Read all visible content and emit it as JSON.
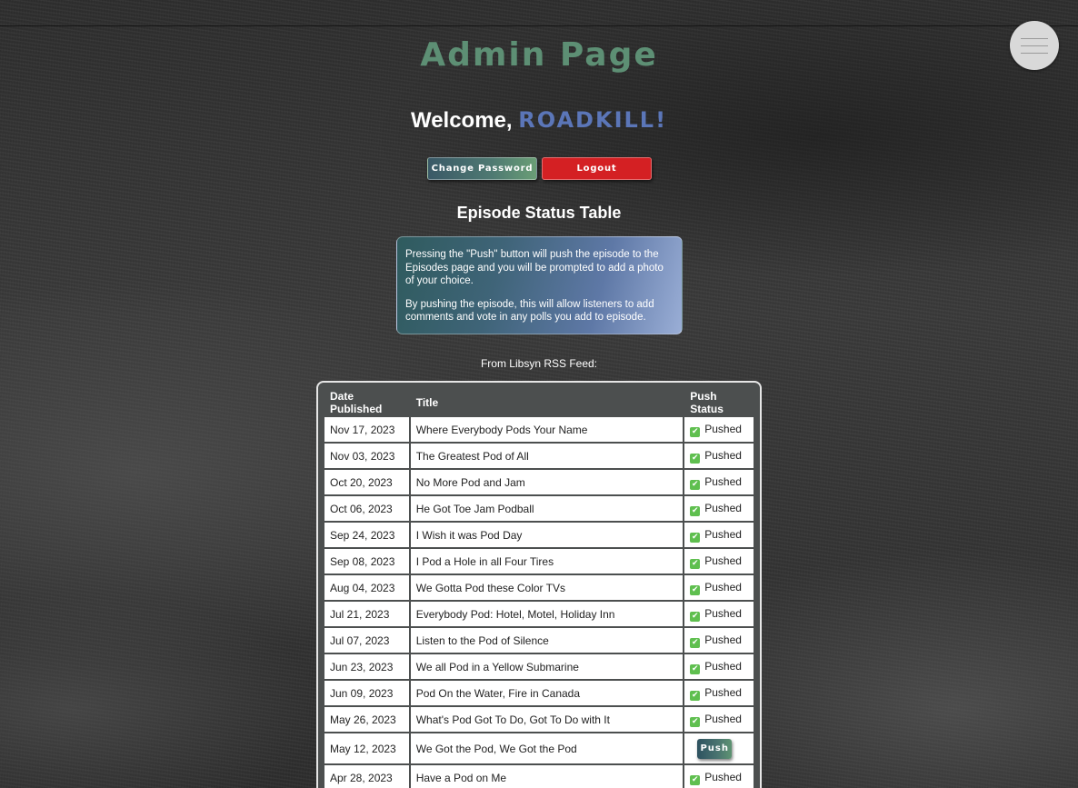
{
  "header": {
    "title": "Admin Page",
    "menu_icon": "hamburger-icon"
  },
  "welcome": {
    "greeting": "Welcome, ",
    "username": "ROADKILL!"
  },
  "actions": {
    "change_password_label": "Change Password",
    "logout_label": "Logout"
  },
  "section": {
    "title": "Episode Status Table"
  },
  "info": {
    "paragraph1": "Pressing the \"Push\" button will push the episode to the Episodes page and you will be prompted to add a photo of your choice.",
    "paragraph2": "By pushing the episode, this will allow listeners to add comments and vote in any polls you add to episode."
  },
  "feed": {
    "label": "From Libsyn RSS Feed:"
  },
  "table": {
    "headers": {
      "date": "Date Published",
      "title": "Title",
      "status": "Push Status"
    },
    "rows": [
      {
        "date": "Nov 17, 2023",
        "title": "Where Everybody Pods Your Name",
        "status": "Pushed"
      },
      {
        "date": "Nov 03, 2023",
        "title": "The Greatest Pod of All",
        "status": "Pushed"
      },
      {
        "date": "Oct 20, 2023",
        "title": "No More Pod and Jam",
        "status": "Pushed"
      },
      {
        "date": "Oct 06, 2023",
        "title": "He Got Toe Jam Podball",
        "status": "Pushed"
      },
      {
        "date": "Sep 24, 2023",
        "title": "I Wish it was Pod Day",
        "status": "Pushed"
      },
      {
        "date": "Sep 08, 2023",
        "title": "I Pod a Hole in all Four Tires",
        "status": "Pushed"
      },
      {
        "date": "Aug 04, 2023",
        "title": "We Gotta Pod these Color TVs",
        "status": "Pushed"
      },
      {
        "date": "Jul 21, 2023",
        "title": "Everybody Pod: Hotel, Motel, Holiday Inn",
        "status": "Pushed"
      },
      {
        "date": "Jul 07, 2023",
        "title": "Listen to the Pod of Silence",
        "status": "Pushed"
      },
      {
        "date": "Jun 23, 2023",
        "title": "We all Pod in a Yellow Submarine",
        "status": "Pushed"
      },
      {
        "date": "Jun 09, 2023",
        "title": "Pod On the Water, Fire in Canada",
        "status": "Pushed"
      },
      {
        "date": "May 26, 2023",
        "title": "What's Pod Got To Do, Got To Do with It",
        "status": "Pushed"
      },
      {
        "date": "May 12, 2023",
        "title": "We Got the Pod, We Got the Pod",
        "status": "Push"
      },
      {
        "date": "Apr 28, 2023",
        "title": "Have a Pod on Me",
        "status": "Pushed"
      }
    ]
  },
  "colors": {
    "title_green": "#5d8f74",
    "username_blue": "#5b76b8",
    "logout_red": "#d42023",
    "pushed_check": "#5fbf4f"
  }
}
